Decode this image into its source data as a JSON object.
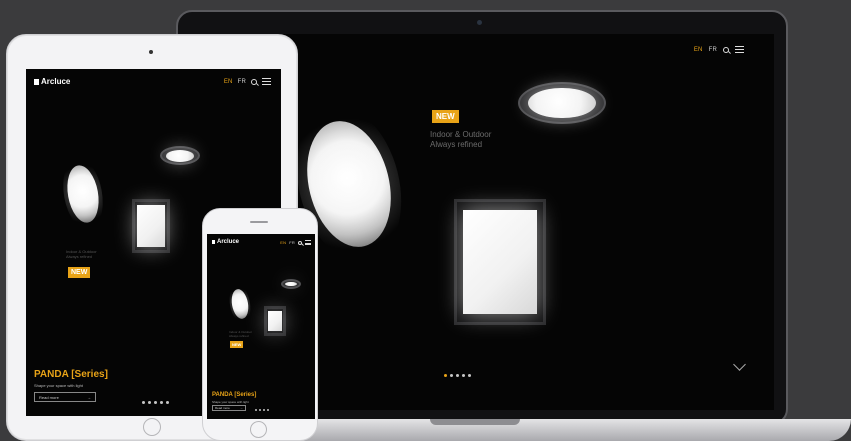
{
  "brand": "Arcluce",
  "nav": {
    "lang_en": "EN",
    "lang_fr": "FR"
  },
  "hero": {
    "badge": "NEW",
    "tagline_line1": "Indoor & Outdoor",
    "tagline_line2": "Always refined"
  },
  "series": {
    "title": "PANDA [Series]",
    "subtitle": "Shape your space with light",
    "cta": "Read more",
    "cta_arrow": "→"
  },
  "slider": {
    "count": 5,
    "active_index": 0
  },
  "colors": {
    "accent": "#e8a317",
    "screen_bg": "#050505",
    "backdrop": "#3b3b3d"
  },
  "icons": [
    "search-icon",
    "menu-icon",
    "chevron-down-icon",
    "logo-mark-icon",
    "arrow-right-icon"
  ]
}
